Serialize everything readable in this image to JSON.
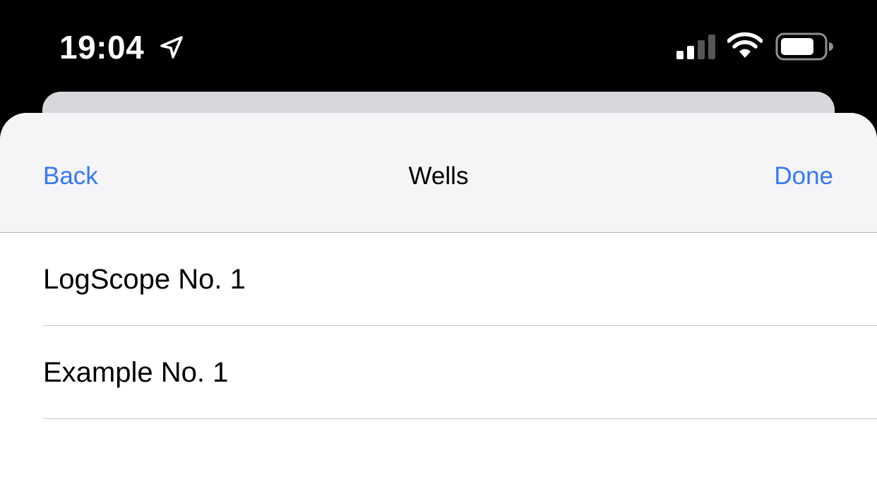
{
  "status_bar": {
    "time": "19:04",
    "icons": [
      "location-arrow-icon",
      "cellular-signal-icon",
      "wifi-icon",
      "battery-icon"
    ]
  },
  "nav": {
    "back_label": "Back",
    "title": "Wells",
    "done_label": "Done"
  },
  "list": {
    "items": [
      {
        "label": "LogScope No. 1"
      },
      {
        "label": "Example No. 1"
      }
    ]
  },
  "colors": {
    "accent": "#3478f6",
    "nav_background": "#f5f5f7",
    "status_bar_background": "#000000"
  }
}
